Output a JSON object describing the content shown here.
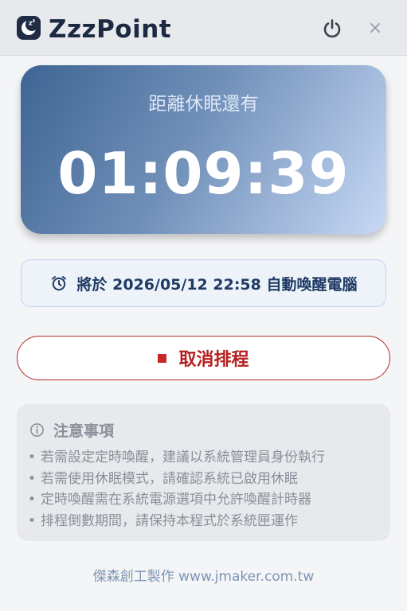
{
  "app": {
    "title": "ZzzPoint",
    "logo_icon": "moon-zzz-icon",
    "close_glyph": "×"
  },
  "countdown": {
    "label": "距離休眠還有",
    "time": "01:09:39"
  },
  "wake": {
    "icon": "alarm-clock-icon",
    "text": "將於 2026/05/12 22:58 自動喚醒電腦"
  },
  "cancel": {
    "label": "取消排程",
    "icon": "stop-icon"
  },
  "notice": {
    "title": "注意事項",
    "icon": "info-icon",
    "items": [
      "若需設定定時喚醒，建議以系統管理員身份執行",
      "若需使用休眠模式，請確認系統已啟用休眠",
      "定時喚醒需在系統電源選項中允許喚醒計時器",
      "排程倒數期間，請保持本程式於系統匣運作"
    ]
  },
  "footer": {
    "credit": "傑森創工製作 www.jmaker.com.tw"
  },
  "colors": {
    "card_gradient_start": "#3e6593",
    "card_gradient_end": "#c8d9f6",
    "cancel_accent": "#b51f1f",
    "title_text": "#1b2a41",
    "footer_text": "#7d95b3"
  }
}
